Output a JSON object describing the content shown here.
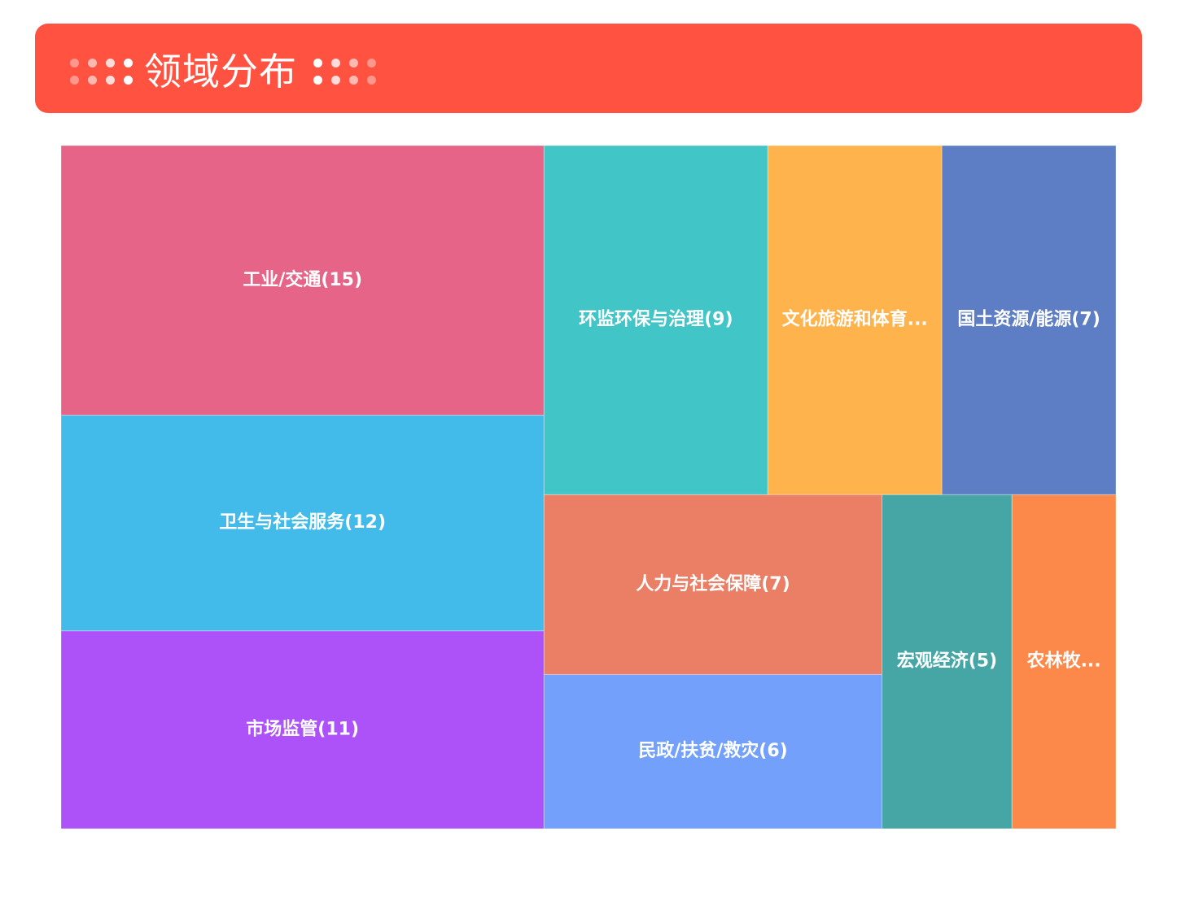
{
  "header": {
    "title": "领域分布",
    "background_color": "#ff5240",
    "left_dots": [
      "#ffffff66",
      "#ffffff99",
      "#ffffffcc",
      "#ffffff",
      "#ffffff66",
      "#ffffff99",
      "#ffffffcc",
      "#ffffff"
    ],
    "right_dots": [
      "#ffffff",
      "#ffffffcc",
      "#ffffff99",
      "#ffffff66",
      "#ffffff",
      "#ffffffcc",
      "#ffffff99",
      "#ffffff66"
    ]
  },
  "chart_data": {
    "type": "treemap",
    "items": [
      {
        "name": "工业/交通",
        "value": 15,
        "label": "工业/交通(15)",
        "color": "#e66487"
      },
      {
        "name": "卫生与社会服务",
        "value": 12,
        "label": "卫生与社会服务(12)",
        "color": "#43bbea"
      },
      {
        "name": "市场监管",
        "value": 11,
        "label": "市场监管(11)",
        "color": "#ac52f8"
      },
      {
        "name": "环监环保与治理",
        "value": 9,
        "label": "环监环保与治理(9)",
        "color": "#42c5c7"
      },
      {
        "name": "文化旅游和体育",
        "value": 7,
        "label": "文化旅游和体育...",
        "color": "#ffb34d"
      },
      {
        "name": "国土资源/能源",
        "value": 7,
        "label": "国土资源/能源(7)",
        "color": "#5d7ec4"
      },
      {
        "name": "人力与社会保障",
        "value": 7,
        "label": "人力与社会保障(7)",
        "color": "#eb7f66"
      },
      {
        "name": "民政/扶贫/救灾",
        "value": 6,
        "label": "民政/扶贫/救灾(6)",
        "color": "#73a0fa"
      },
      {
        "name": "宏观经济",
        "value": 5,
        "label": "宏观经济(5)",
        "color": "#46a6a6"
      },
      {
        "name": "农林牧",
        "value": 4,
        "label": "农林牧...",
        "color": "#fc8949"
      }
    ]
  }
}
